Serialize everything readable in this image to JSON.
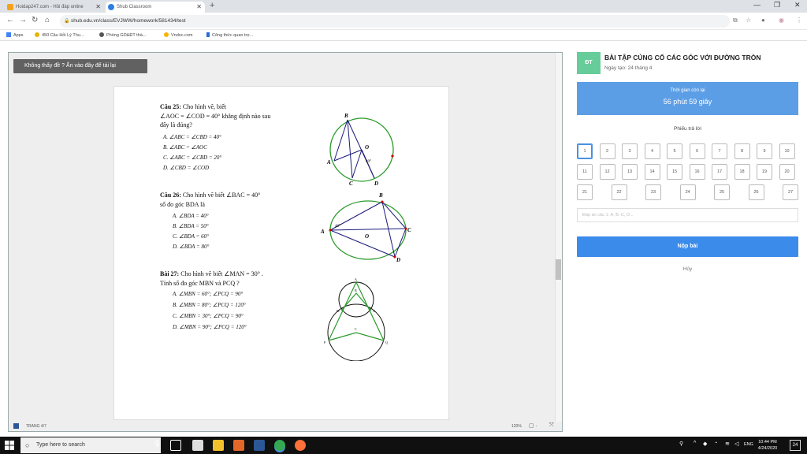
{
  "browser": {
    "tabs": [
      {
        "title": "Hoidap247.com - Hỏi đáp online"
      },
      {
        "title": "Shub Classroom"
      }
    ],
    "url": "shub.edu.vn/class/EVJWW/homework/581434/test",
    "bookmarks": [
      {
        "label": "Apps"
      },
      {
        "label": "450 Câu Hỏi Lý Thu..."
      },
      {
        "label": "Phòng GD&ĐT thà..."
      },
      {
        "label": "Vndoc.com"
      },
      {
        "label": "Công thức quan trọ..."
      }
    ]
  },
  "viewer": {
    "reload_button": "Không thấy đề ? Ấn vào đây để tải lại",
    "page_status": "TRANG 4/7",
    "zoom": "120%"
  },
  "questions": [
    {
      "heading": "Câu 25:",
      "stem": [
        " Cho hình vẽ, biết",
        "∠AOC = ∠COD = 40°  khẳng định nào sau",
        "đây là đúng?"
      ],
      "options": [
        "A.  ∠ABC = ∠CBD = 40°",
        "B.  ∠ABC = ∠AOC",
        "C.  ∠ABC = ∠CBD = 20°",
        "D.  ∠CBD = ∠COD"
      ]
    },
    {
      "heading": "Câu 26:",
      "stem": [
        " Cho hình vẽ biết  ∠BAC = 40°",
        "số đo góc BDA là"
      ],
      "options": [
        "A.  ∠BDA = 40°",
        "B.  ∠BDA = 50°",
        "C.  ∠BDA = 60°",
        "D.  ∠BDA = 80°"
      ]
    },
    {
      "heading": "Bài 27:",
      "stem": [
        " Cho hình vẽ biết  ∠MAN = 30° .",
        "Tính số đo góc MBN và PCQ ?"
      ],
      "options": [
        "A.  ∠MBN = 60°; ∠PCQ = 90°",
        "B.  ∠MBN = 80°; ∠PCQ = 120°",
        "C.  ∠MBN = 30°; ∠PCQ = 90°",
        "D.  ∠MBN = 90°; ∠PCQ = 120°"
      ]
    }
  ],
  "figures": {
    "fig1": {
      "B": "B",
      "O": "O",
      "A": "A",
      "C": "C",
      "D": "D",
      "angle": "40°"
    },
    "fig2": {
      "B": "B",
      "A": "A",
      "C": "C",
      "O": "O",
      "D": "D",
      "angle": "40°"
    },
    "fig3": {
      "A": "A",
      "B": "B",
      "M": "M",
      "N": "N",
      "C": "C",
      "P": "P",
      "Q": "Q"
    }
  },
  "panel": {
    "badge": "ĐT",
    "title": "BÀI TẬP CỦNG CỐ CÁC GÓC VỚI ĐƯỜNG TRÒN",
    "created": "Ngày tạo: 24 tháng 4",
    "timer_label": "Thời gian còn lại",
    "timer_value": "56 phút 59 giây",
    "sheet_label": "Phiếu trả lời",
    "answer_placeholder": "Đáp án câu 1: A, B, C, D...",
    "submit": "Nộp bài",
    "cancel": "Hủy",
    "selected_question": 1,
    "question_numbers": [
      "1",
      "2",
      "3",
      "4",
      "5",
      "6",
      "7",
      "8",
      "9",
      "10",
      "11",
      "12",
      "13",
      "14",
      "15",
      "16",
      "17",
      "18",
      "19",
      "20",
      "21",
      "22",
      "23",
      "24",
      "25",
      "26",
      "27"
    ]
  },
  "taskbar": {
    "search_placeholder": "Type here to search",
    "time": "10:44 PM",
    "date": "4/24/2020",
    "lang": "ENG",
    "notifications": "24"
  },
  "colors": {
    "accent_blue": "#3b8beb",
    "timer_blue": "#5c9ee6",
    "badge_green": "#66cc99",
    "circle_green": "#2a9a2a",
    "line_navy": "#1a1a7a"
  }
}
